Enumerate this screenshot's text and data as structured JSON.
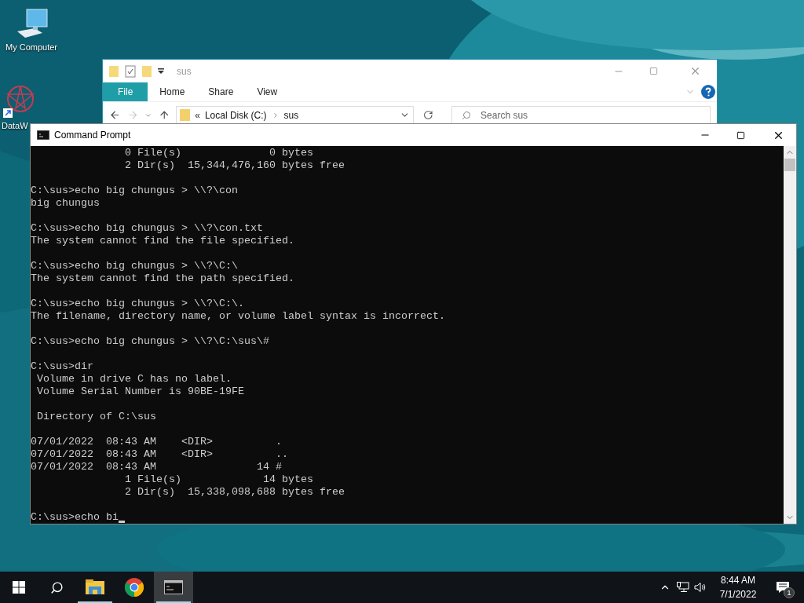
{
  "desktop": {
    "icons": [
      {
        "label": "My Computer",
        "kind": "computer"
      },
      {
        "label": "DataW",
        "kind": "shortcut"
      }
    ]
  },
  "explorer": {
    "title": "sus",
    "tabs": [
      {
        "label": "File",
        "selected": true
      },
      {
        "label": "Home",
        "selected": false
      },
      {
        "label": "Share",
        "selected": false
      },
      {
        "label": "View",
        "selected": false
      }
    ],
    "address": {
      "overflow": "«",
      "crumbs": [
        "Local Disk (C:)",
        "sus"
      ]
    },
    "search": {
      "placeholder": "Search sus"
    }
  },
  "console": {
    "title": "Command Prompt",
    "blocks": [
      [
        "               0 File(s)              0 bytes",
        "               2 Dir(s)  15,344,476,160 bytes free"
      ],
      [
        "C:\\sus>echo big chungus > \\\\?\\con",
        "big chungus"
      ],
      [
        "C:\\sus>echo big chungus > \\\\?\\con.txt",
        "The system cannot find the file specified."
      ],
      [
        "C:\\sus>echo big chungus > \\\\?\\C:\\",
        "The system cannot find the path specified."
      ],
      [
        "C:\\sus>echo big chungus > \\\\?\\C:\\.",
        "The filename, directory name, or volume label syntax is incorrect."
      ],
      [
        "C:\\sus>echo big chungus > \\\\?\\C:\\sus\\#"
      ],
      [
        "C:\\sus>dir",
        " Volume in drive C has no label.",
        " Volume Serial Number is 90BE-19FE"
      ],
      [
        " Directory of C:\\sus"
      ],
      [
        "07/01/2022  08:43 AM    <DIR>          .",
        "07/01/2022  08:43 AM    <DIR>          ..",
        "07/01/2022  08:43 AM                14 #",
        "               1 File(s)             14 bytes",
        "               2 Dir(s)  15,338,098,688 bytes free"
      ],
      [
        "C:\\sus>echo bi"
      ]
    ]
  },
  "taskbar": {
    "apps": [
      {
        "kind": "explorer",
        "running": true,
        "active": false
      },
      {
        "kind": "chrome",
        "running": false,
        "active": false
      },
      {
        "kind": "terminal",
        "running": true,
        "active": true
      }
    ],
    "clock": {
      "time": "8:44 AM",
      "date": "7/1/2022"
    },
    "notifications": {
      "count": "1"
    }
  }
}
